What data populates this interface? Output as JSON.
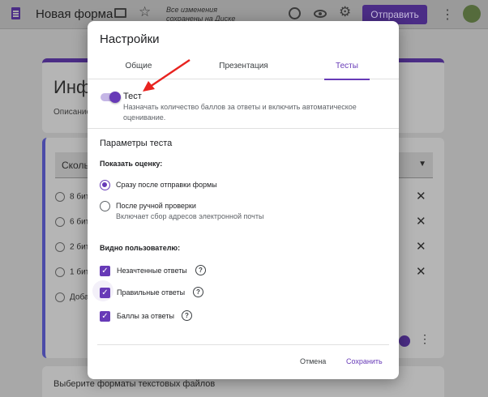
{
  "header": {
    "form_title": "Новая форма",
    "saved_status": "Все изменения сохранены на Диске",
    "send_label": "Отправить"
  },
  "background": {
    "title": "Инф",
    "description": "Описание",
    "question_select": "Скольк",
    "options": [
      "8 бит",
      "6 бит",
      "2 бит",
      "1 бит",
      "Доба"
    ],
    "bottom_text": "Выберите форматы текстовых файлов"
  },
  "dialog": {
    "title": "Настройки",
    "tabs": [
      {
        "label": "Общие",
        "active": false
      },
      {
        "label": "Презентация",
        "active": false
      },
      {
        "label": "Тесты",
        "active": true
      }
    ],
    "quiz_toggle": {
      "label": "Тест",
      "on": true,
      "description": "Назначать количество баллов за ответы и включить автоматическое оценивание."
    },
    "quiz_params_title": "Параметры теста",
    "show_grade": {
      "heading": "Показать оценку:",
      "options": [
        {
          "label": "Сразу после отправки формы",
          "checked": true,
          "sublabel": ""
        },
        {
          "label": "После ручной проверки",
          "checked": false,
          "sublabel": "Включает сбор адресов электронной почты"
        }
      ]
    },
    "visible_to_user": {
      "heading": "Видно пользователю:",
      "items": [
        {
          "label": "Незачтенные ответы",
          "checked": true
        },
        {
          "label": "Правильные ответы",
          "checked": true
        },
        {
          "label": "Баллы за ответы",
          "checked": true
        }
      ]
    },
    "cancel_label": "Отмена",
    "save_label": "Сохранить"
  },
  "colors": {
    "accent": "#673ab7",
    "annotation_arrow": "#e8231f"
  }
}
